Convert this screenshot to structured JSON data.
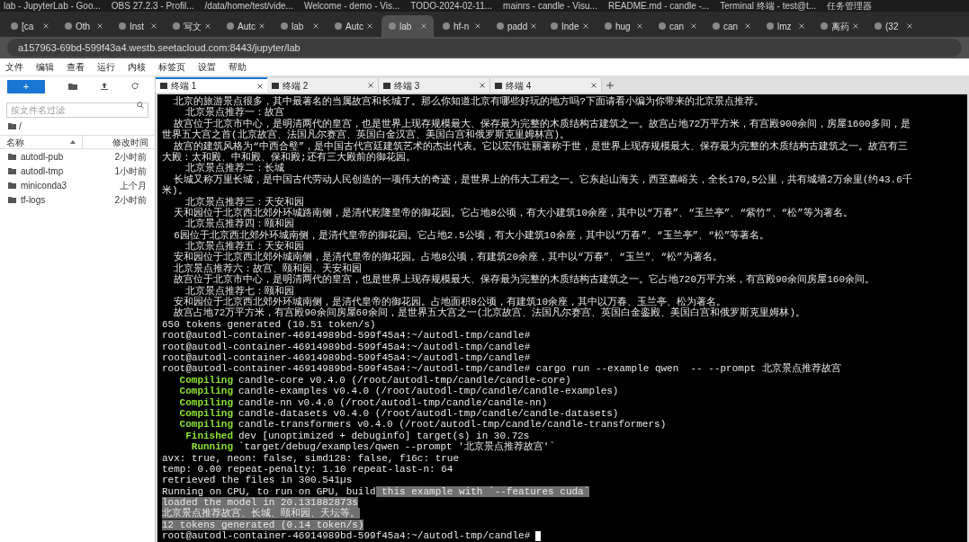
{
  "taskbar": [
    "lab - JupyterLab - Goo...",
    "OBS 27.2.3 - Profil...",
    "/data/home/test/vide...",
    "Welcome - demo - Vis...",
    "TODO-2024-02-11...",
    "mainrs - candle - Visu...",
    "README.md - candle -...",
    "Terminal 终端 - test@t...",
    "任务管理器"
  ],
  "browser_tabs": [
    {
      "label": "[ca",
      "selected": false
    },
    {
      "label": "Oth",
      "selected": false
    },
    {
      "label": "Inst",
      "selected": false
    },
    {
      "label": "写文",
      "selected": false
    },
    {
      "label": "Autc",
      "selected": false
    },
    {
      "label": "lab",
      "selected": false
    },
    {
      "label": "Autc",
      "selected": false
    },
    {
      "label": "lab",
      "selected": true
    },
    {
      "label": "hf-n",
      "selected": false
    },
    {
      "label": "padd",
      "selected": false
    },
    {
      "label": "Inde",
      "selected": false
    },
    {
      "label": "hug",
      "selected": false
    },
    {
      "label": "can",
      "selected": false
    },
    {
      "label": "can",
      "selected": false
    },
    {
      "label": "lmz",
      "selected": false
    },
    {
      "label": "离药",
      "selected": false
    },
    {
      "label": "(32",
      "selected": false
    }
  ],
  "address": "a157963-69bd-599f43a4.westb.seetacloud.com:8443/jupyter/lab",
  "menu": [
    "文件",
    "编辑",
    "查看",
    "运行",
    "内核",
    "标签页",
    "设置",
    "帮助"
  ],
  "sidebar": {
    "new_button": "+",
    "filter": {
      "placeholder": "按文件名过滤"
    },
    "path": "/",
    "columns": [
      "名称",
      "修改时间"
    ],
    "files": [
      {
        "name": "autodl-pub",
        "modified": "2小时前"
      },
      {
        "name": "autodl-tmp",
        "modified": "1小时前"
      },
      {
        "name": "miniconda3",
        "modified": "上个月"
      },
      {
        "name": "tf-logs",
        "modified": "2小时前"
      }
    ]
  },
  "terminal_tabs": [
    {
      "label": "终端 1",
      "selected": true
    },
    {
      "label": "终端 2",
      "selected": false
    },
    {
      "label": "终端 3",
      "selected": false
    },
    {
      "label": "终端 4",
      "selected": false
    }
  ],
  "terminal": [
    {
      "kind": "plain",
      "text": "  北京的旅游景点很多，其中最著名的当属故宫和长城了。那么你知道北京有哪些好玩的地方吗?下面请看小编为你带来的北京景点推荐。"
    },
    {
      "kind": "plain",
      "text": "    北京景点推荐一：故宫"
    },
    {
      "kind": "plain",
      "text": "  故宫位于北京市中心，是明清两代的皇宫，也是世界上现存规模最大、保存最为完整的木质结构古建筑之一。故宫占地72万平方米，有宫殿900余间，房屋1600多间，是"
    },
    {
      "kind": "plain",
      "text": "世界五大宫之首(北京故宫、法国凡尔赛宫、英国白金汉宫、美国白宫和俄罗斯克里姆林宫)。"
    },
    {
      "kind": "plain",
      "text": "  故宫的建筑风格为“中西合璧”，是中国古代宫廷建筑艺术的杰出代表。它以宏伟壮丽著称于世，是世界上现存规模最大、保存最为完整的木质结构古建筑之一。故宫有三"
    },
    {
      "kind": "plain",
      "text": "大殿：太和殿、中和殿、保和殿;还有三大殿前的御花园。"
    },
    {
      "kind": "plain",
      "text": "    北京景点推荐二：长城"
    },
    {
      "kind": "plain",
      "text": "  长城又称万里长城，是中国古代劳动人民创造的一项伟大的奇迹，是世界上的伟大工程之一。它东起山海关，西至嘉峪关，全长170,5公里，共有城墙2万余里(约43.6千"
    },
    {
      "kind": "plain",
      "text": "米)。"
    },
    {
      "kind": "plain",
      "text": "    北京景点推荐三：天安和园"
    },
    {
      "kind": "plain",
      "text": "  天和园位于北京西北郊外环城路南侧，是清代乾隆皇帝的御花园。它占地8公顷，有大小建筑10余座，其中以“万春”、“玉兰亭”、“紫竹”、“松”等为著名。"
    },
    {
      "kind": "plain",
      "text": "    北京景点推荐四：颐和园"
    },
    {
      "kind": "plain",
      "text": "  6园位于北京西北郊外环城南侧，是清代皇帝的御花园。它占地2.5公顷，有大小建筑10余座，其中以“万春”、“玉兰亭”、“松”等著名。"
    },
    {
      "kind": "plain",
      "text": "    北京景点推荐五：天安和园"
    },
    {
      "kind": "plain",
      "text": "  安和园位于北京西北郊外城南侧，是清代皇帝的御花园。占地8公顷，有建筑20余座，其中以“万春”、“玉兰”、“松”为著名。"
    },
    {
      "kind": "plain",
      "text": "  北京景点推荐六：故宫、颐和园、天安和园"
    },
    {
      "kind": "plain",
      "text": "  故宫位于北京市中心，是明清两代的皇宫，也是世界上现存规模最大、保存最为完整的木质结构古建筑之一。它占地720万平方米，有宫殿90余间房屋160余间。"
    },
    {
      "kind": "plain",
      "text": "    北京景点推荐七：颐和园"
    },
    {
      "kind": "plain",
      "text": "  安和园位于北京西北郊外环城南侧，是清代皇帝的御花园。占地面积8公顷，有建筑10余座，其中以万春、玉兰亭、松为著名。"
    },
    {
      "kind": "plain",
      "text": "  故宫占地72万平方米，有宫殿90余间房屋60余间，是世界五大宫之一(北京故宫、法国凡尔赛宫、英国白金銮殿、美国白宫和俄罗斯克里姆林)。"
    },
    {
      "kind": "plain",
      "text": "650 tokens generated (10.51 token/s)"
    },
    {
      "kind": "plain",
      "text": "root@autodl-container-46914989bd-599f45a4:~/autodl-tmp/candle#"
    },
    {
      "kind": "plain",
      "text": "root@autodl-container-46914989bd-599f45a4:~/autodl-tmp/candle#"
    },
    {
      "kind": "plain",
      "text": "root@autodl-container-46914989bd-599f45a4:~/autodl-tmp/candle#"
    },
    {
      "kind": "plain",
      "text": "root@autodl-container-46914989bd-599f45a4:~/autodl-tmp/candle# cargo run --example qwen  -- --prompt 北京景点推荐故宫"
    },
    {
      "kind": "cargo",
      "status": "Compiling",
      "text": "candle-core v0.4.0 (/root/autodl-tmp/candle/candle-core)"
    },
    {
      "kind": "cargo",
      "status": "Compiling",
      "text": "candle-examples v0.4.0 (/root/autodl-tmp/candle/candle-examples)"
    },
    {
      "kind": "cargo",
      "status": "Compiling",
      "text": "candle-nn v0.4.0 (/root/autodl-tmp/candle/candle-nn)"
    },
    {
      "kind": "cargo",
      "status": "Compiling",
      "text": "candle-datasets v0.4.0 (/root/autodl-tmp/candle/candle-datasets)"
    },
    {
      "kind": "cargo",
      "status": "Compiling",
      "text": "candle-transformers v0.4.0 (/root/autodl-tmp/candle/candle-transformers)"
    },
    {
      "kind": "cargo",
      "status": "Finished",
      "text": "dev [unoptimized + debuginfo] target(s) in 30.72s"
    },
    {
      "kind": "cargo",
      "status": "Running",
      "text": "`target/debug/examples/qwen --prompt '北京景点推荐故宫'`"
    },
    {
      "kind": "plain",
      "text": "avx: true, neon: false, simd128: false, f16c: true"
    },
    {
      "kind": "plain",
      "text": "temp: 0.00 repeat-penalty: 1.10 repeat-last-n: 64"
    },
    {
      "kind": "plain",
      "text": "retrieved the files in 300.541µs"
    },
    {
      "kind": "split",
      "text": "Running on CPU, to run on GPU, build",
      "selected_text": " this example with `--features cuda`"
    },
    {
      "kind": "selected",
      "text": "loaded the model in 20.131882873s"
    },
    {
      "kind": "selected",
      "text": "北京景点推荐故宫、长城、颐和园、天坛等。"
    },
    {
      "kind": "selected",
      "text": "12 tokens generated (0.14 token/s)"
    },
    {
      "kind": "prompt",
      "text": "root@autodl-container-46914989bd-599f45a4:~/autodl-tmp/candle#"
    }
  ]
}
